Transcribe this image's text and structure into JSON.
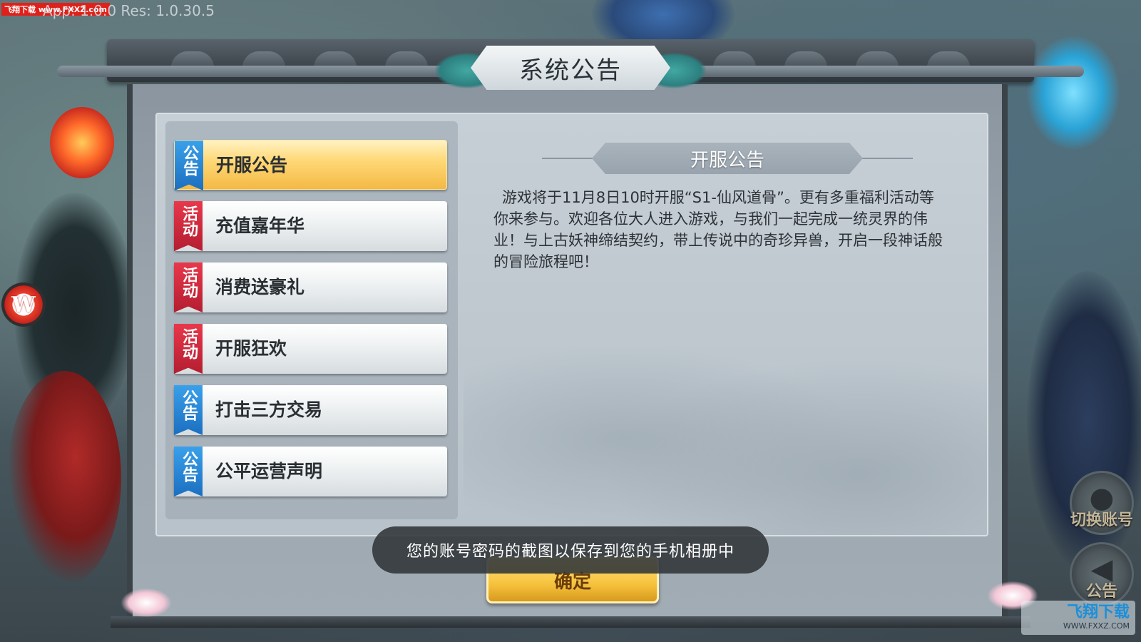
{
  "overlay": {
    "watermark_top": "飞翔下载 www.FXXZ.com",
    "version": "App: 1.0.0 Res: 1.0.30.5"
  },
  "side_logo": {
    "glyph": "W"
  },
  "dialog": {
    "title": "系统公告",
    "list": [
      {
        "tag": "公告",
        "tag_type": "notice",
        "label": "开服公告",
        "selected": true
      },
      {
        "tag": "活动",
        "tag_type": "event",
        "label": "充值嘉年华",
        "selected": false
      },
      {
        "tag": "活动",
        "tag_type": "event",
        "label": "消费送豪礼",
        "selected": false
      },
      {
        "tag": "活动",
        "tag_type": "event",
        "label": "开服狂欢",
        "selected": false
      },
      {
        "tag": "公告",
        "tag_type": "notice",
        "label": "打击三方交易",
        "selected": false
      },
      {
        "tag": "公告",
        "tag_type": "notice",
        "label": "公平运营声明",
        "selected": false
      }
    ],
    "article": {
      "title": "开服公告",
      "body": "游戏将于11月8日10时开服“S1-仙风道骨”。更有多重福利活动等你来参与。欢迎各位大人进入游戏，与我们一起完成一统灵界的伟业！与上古妖神缔结契约，带上传说中的奇珍异兽，开启一段神话般的冒险旅程吧！"
    },
    "confirm_label": "确定"
  },
  "toast": "您的账号密码的截图以保存到您的手机相册中",
  "side_buttons": {
    "switch_account": "切换账号",
    "notice": "公告"
  },
  "watermark_bottom": {
    "brand": "飞翔下载",
    "url": "WWW.FXXZ.COM"
  },
  "colors": {
    "notice_tag": "#1b6fc0",
    "event_tag": "#b41d30",
    "selected_item": "#f4b944",
    "confirm_button": "#f6c23d"
  }
}
